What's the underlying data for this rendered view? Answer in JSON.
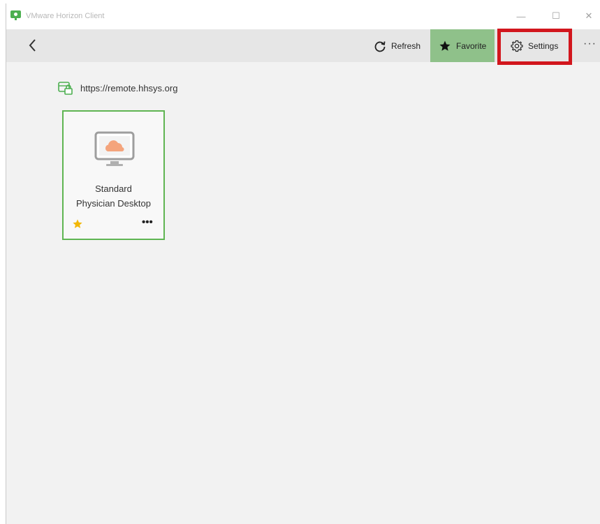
{
  "window": {
    "title": "VMware Horizon Client",
    "minimize_glyph": "—",
    "maximize_glyph": "☐",
    "close_glyph": "✕"
  },
  "toolbar": {
    "refresh_label": "Refresh",
    "favorite_label": "Favorite",
    "settings_label": "Settings",
    "more_label": "···",
    "favorite_bg": "#8fc18a",
    "highlight_color": "#d2161d"
  },
  "server": {
    "url": "https://remote.hhsys.org",
    "icon": "server-lock-icon"
  },
  "desktops": [
    {
      "name_line1": "Standard",
      "name_line2": "Physician Desktop",
      "favorite": true,
      "more_label": "•••",
      "icon": "cloud-monitor-icon",
      "border_color": "#5fb552"
    }
  ],
  "icons": {
    "app": "horizon-logo-icon",
    "back": "chevron-left-icon",
    "refresh": "refresh-icon",
    "favorite": "star-icon",
    "settings": "gear-icon"
  }
}
